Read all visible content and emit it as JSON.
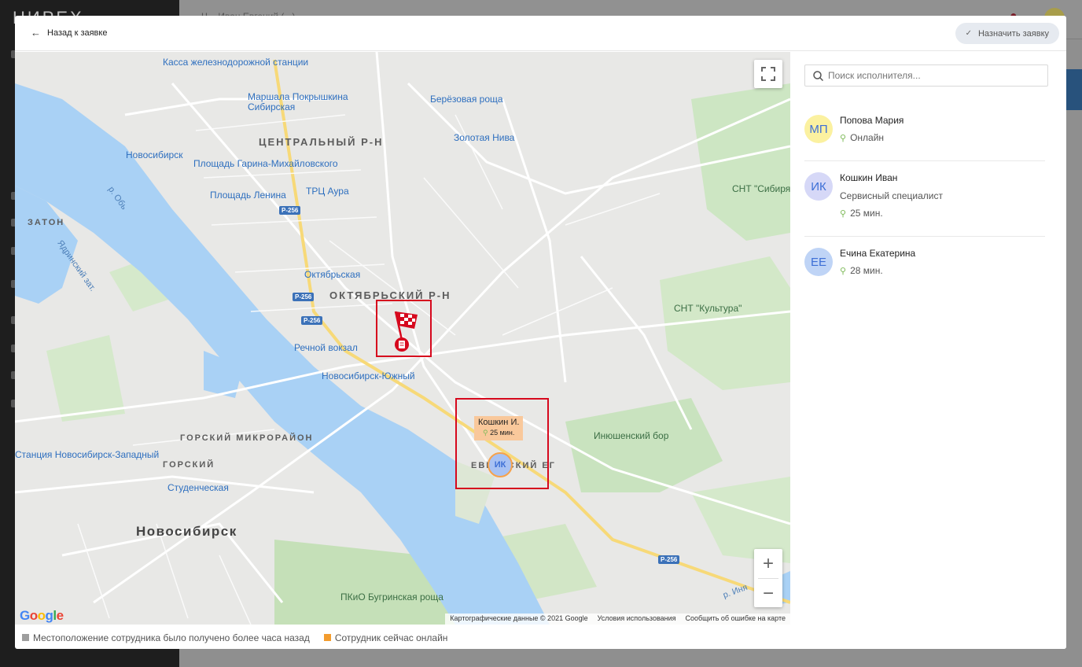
{
  "background_app": {
    "logo": "НИРЕХ",
    "header_text": "Ч... Иван Евгений (...) ...",
    "avatar_initials": "МР"
  },
  "modal": {
    "back_label": "Назад к заявке",
    "assign_label": "Назначить заявку"
  },
  "map": {
    "labels_blue": [
      "Касса железнодорожной станции",
      "Маршала Покрышкина",
      "Сибирская",
      "Берёзовая роща",
      "Золотая Нива",
      "Новосибирск",
      "Площадь Гарина-Михайловского",
      "Площадь Ленина",
      "ТРЦ Аура",
      "Октябрьская",
      "Речной вокзал",
      "Новосибирск-Южный",
      "Студенческая",
      "Станция Новосибирск-Западный"
    ],
    "districts": [
      "ЦЕНТРАЛЬНЫЙ Р-Н",
      "ОКТЯБРЬСКИЙ Р-Н",
      "ГОРСКИЙ МИКРОРАЙОН",
      "ГОРСКИЙ",
      "ЕВГЕНСКИЙ ЕГ",
      "ЗАТОН"
    ],
    "city": "Новосибирск",
    "parks": [
      "СНТ \"Сибиряк\"",
      "СНТ \"Культура\"",
      "Инюшенский бор",
      "ПКиО Бугринская роща"
    ],
    "water": [
      "р. Обь",
      "Ядринский зат.",
      "р. Иня"
    ],
    "road_shield": "Р-256",
    "google_logo": "Google",
    "attribution": {
      "data": "Картографические данные © 2021 Google",
      "terms": "Условия использования",
      "report": "Сообщить об ошибке на карте"
    },
    "worker_tag": {
      "name": "Кошкин И.",
      "time": "25 мин.",
      "initials": "ИК"
    }
  },
  "legend": {
    "stale": "Местоположение сотрудника было получено более часа назад",
    "online": "Сотрудник сейчас онлайн",
    "stale_color": "#9e9e9e",
    "online_color": "#f39c2e"
  },
  "panel": {
    "search_placeholder": "Поиск исполнителя...",
    "workers": [
      {
        "initials": "МП",
        "name": "Попова Мария",
        "status": "Онлайн",
        "avatar_bg": "#fbf1a0",
        "avatar_fg": "#3d6fd6"
      },
      {
        "initials": "ИК",
        "name": "Кошкин Иван",
        "role": "Сервисный специалист",
        "status": "25 мин.",
        "avatar_bg": "#d6d8f7",
        "avatar_fg": "#3d6fd6"
      },
      {
        "initials": "ЕЕ",
        "name": "Ечина Екатерина",
        "status": "28 мин.",
        "avatar_bg": "#bfd4f6",
        "avatar_fg": "#3d6fd6"
      }
    ]
  }
}
